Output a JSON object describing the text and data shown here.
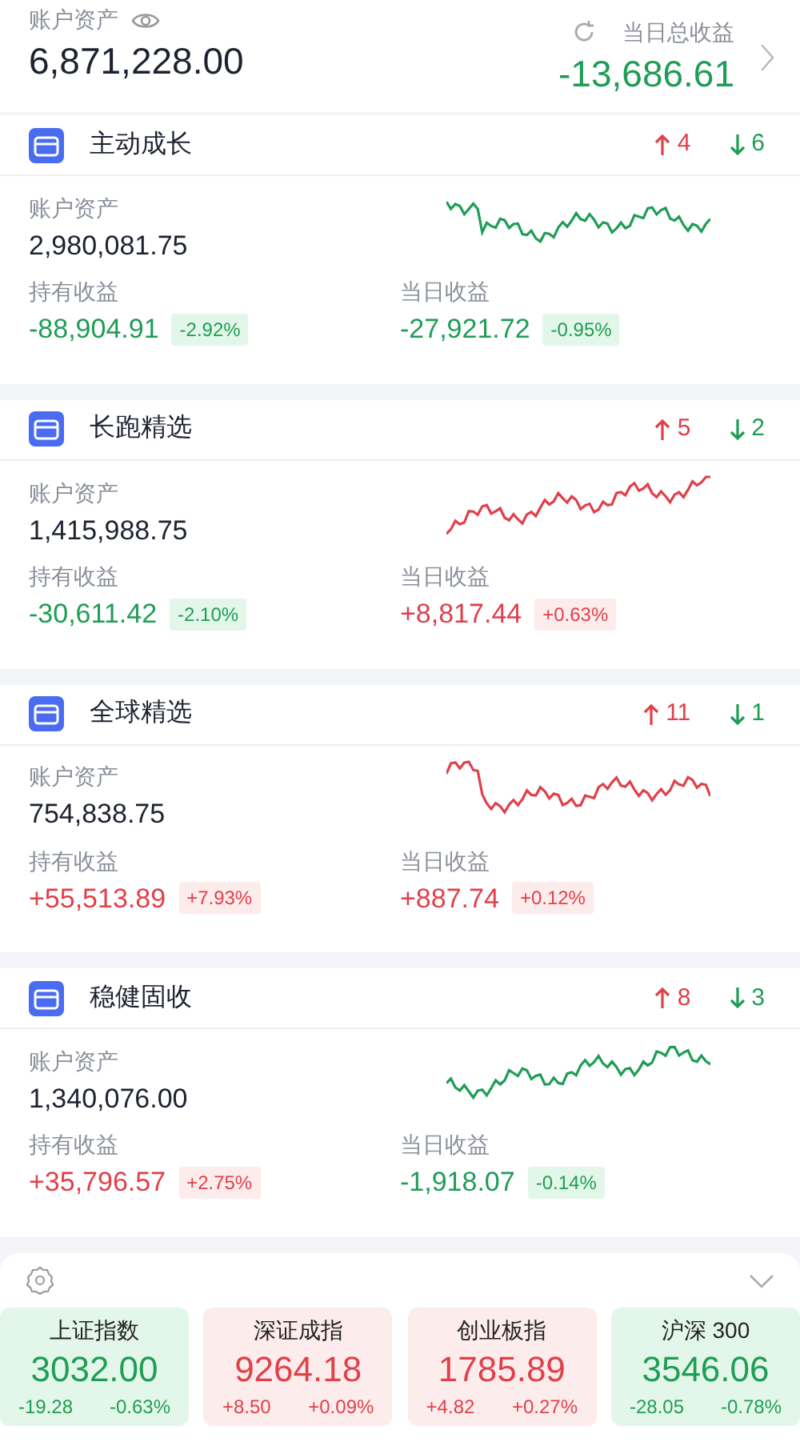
{
  "summary": {
    "assets_label": "账户资产",
    "assets": "6,871,228.00",
    "daily_label": "当日总收益",
    "daily": "-13,686.61",
    "daily_rising": false
  },
  "funds": [
    {
      "name": "主动成长",
      "up_count": "4",
      "down_count": "6",
      "assets_label": "账户资产",
      "assets": "2,980,081.75",
      "chart_rising": false,
      "holding_label": "持有收益",
      "holding": "-88,904.91",
      "holding_pct": "-2.92%",
      "holding_rising": false,
      "daily_label": "当日收益",
      "daily": "-27,921.72",
      "daily_pct": "-0.95%",
      "daily_rising": false
    },
    {
      "name": "长跑精选",
      "up_count": "5",
      "down_count": "2",
      "assets_label": "账户资产",
      "assets": "1,415,988.75",
      "chart_rising": true,
      "holding_label": "持有收益",
      "holding": "-30,611.42",
      "holding_pct": "-2.10%",
      "holding_rising": false,
      "daily_label": "当日收益",
      "daily": "+8,817.44",
      "daily_pct": "+0.63%",
      "daily_rising": true
    },
    {
      "name": "全球精选",
      "up_count": "11",
      "down_count": "1",
      "assets_label": "账户资产",
      "assets": "754,838.75",
      "chart_rising": true,
      "holding_label": "持有收益",
      "holding": "+55,513.89",
      "holding_pct": "+7.93%",
      "holding_rising": true,
      "daily_label": "当日收益",
      "daily": "+887.74",
      "daily_pct": "+0.12%",
      "daily_rising": true
    },
    {
      "name": "稳健固收",
      "up_count": "8",
      "down_count": "3",
      "assets_label": "账户资产",
      "assets": "1,340,076.00",
      "chart_rising": false,
      "holding_label": "持有收益",
      "holding": "+35,796.57",
      "holding_pct": "+2.75%",
      "holding_rising": true,
      "daily_label": "当日收益",
      "daily": "-1,918.07",
      "daily_pct": "-0.14%",
      "daily_rising": false
    }
  ],
  "indices": [
    {
      "name": "上证指数",
      "value": "3032.00",
      "change": "-19.28",
      "pct": "-0.63%",
      "rising": false
    },
    {
      "name": "深证成指",
      "value": "9264.18",
      "change": "+8.50",
      "pct": "+0.09%",
      "rising": true
    },
    {
      "name": "创业板指",
      "value": "1785.89",
      "change": "+4.82",
      "pct": "+0.27%",
      "rising": true
    },
    {
      "name": "沪深 300",
      "value": "3546.06",
      "change": "-28.05",
      "pct": "-0.78%",
      "rising": false
    }
  ]
}
